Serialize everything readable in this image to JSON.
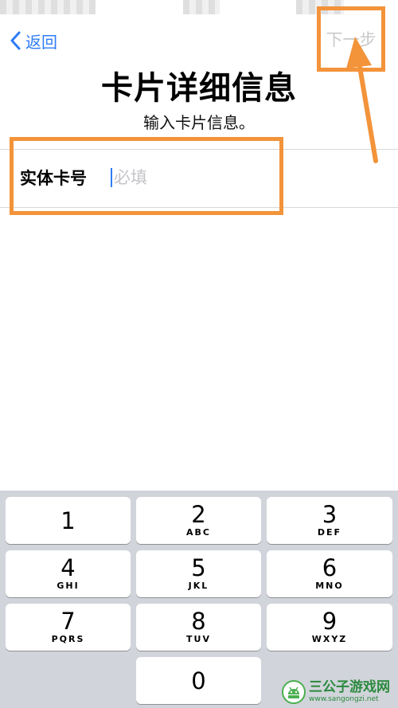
{
  "nav": {
    "back_label": "返回",
    "next_label": "下一步"
  },
  "page": {
    "title": "卡片详细信息",
    "subtitle": "输入卡片信息。"
  },
  "form": {
    "card_number_label": "实体卡号",
    "card_number_placeholder": "必填",
    "card_number_value": ""
  },
  "keypad": {
    "keys": [
      {
        "digit": "1",
        "letters": ""
      },
      {
        "digit": "2",
        "letters": "ABC"
      },
      {
        "digit": "3",
        "letters": "DEF"
      },
      {
        "digit": "4",
        "letters": "GHI"
      },
      {
        "digit": "5",
        "letters": "JKL"
      },
      {
        "digit": "6",
        "letters": "MNO"
      },
      {
        "digit": "7",
        "letters": "PQRS"
      },
      {
        "digit": "8",
        "letters": "TUV"
      },
      {
        "digit": "9",
        "letters": "WXYZ"
      },
      {
        "digit": "0",
        "letters": ""
      }
    ]
  },
  "watermark": {
    "name": "三公子游戏网",
    "url": "www.sangongzi.net"
  },
  "colors": {
    "accent": "#2f7cf6",
    "annotation": "#f3933a",
    "keypad_bg": "#d1d4da",
    "disabled_text": "#c9c9c9"
  },
  "icons": {
    "back": "chevron-left-icon",
    "watermark_logo": "android-logo-icon"
  }
}
